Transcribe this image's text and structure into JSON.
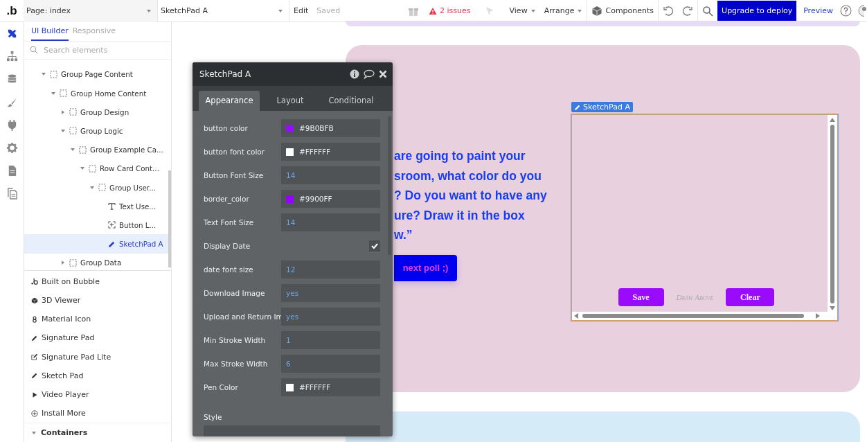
{
  "topbar": {
    "logo": ".b",
    "page_select": "Page: index",
    "element_select": "SketchPad A",
    "edit": "Edit",
    "saved": "Saved",
    "issues": "2 issues",
    "menus": [
      "View",
      "Arrange"
    ],
    "components": "Components",
    "upgrade": "Upgrade to deploy",
    "preview": "Preview"
  },
  "rail": [
    {
      "kind": "design",
      "selected": true
    },
    {
      "kind": "tree",
      "selected": false
    },
    {
      "kind": "data",
      "selected": false
    },
    {
      "kind": "brush",
      "selected": false
    },
    {
      "kind": "plug",
      "selected": false
    },
    {
      "kind": "gear",
      "selected": false
    },
    {
      "kind": "doc",
      "selected": false
    },
    {
      "kind": "docs",
      "selected": false
    }
  ],
  "sidebar": {
    "tabs": [
      {
        "label": "UI Builder",
        "selected": true
      },
      {
        "label": "Responsive",
        "selected": false
      }
    ],
    "search": {
      "placeholder": "Search elements"
    },
    "tree": [
      {
        "label": "Group Page Content",
        "kind": "group",
        "expanded": true,
        "selected": false,
        "children": [
          {
            "label": "Group Home Content",
            "kind": "group",
            "expanded": true,
            "selected": false,
            "children": [
              {
                "label": "Group Design",
                "kind": "group",
                "expanded": false,
                "selected": false
              },
              {
                "label": "Group Logic",
                "kind": "group",
                "expanded": true,
                "selected": false,
                "children": [
                  {
                    "label": "Group Example Ca...",
                    "kind": "group",
                    "expanded": true,
                    "selected": false,
                    "children": [
                      {
                        "label": "Row Card Cont...",
                        "kind": "group",
                        "expanded": true,
                        "selected": false,
                        "children": [
                          {
                            "label": "Group User...",
                            "kind": "group",
                            "expanded": true,
                            "selected": false,
                            "children": [
                              {
                                "label": "Text Use...",
                                "kind": "text",
                                "selected": false
                              },
                              {
                                "label": "Button L...",
                                "kind": "button",
                                "selected": false
                              },
                              {
                                "label": "SketchPad A",
                                "kind": "sketch",
                                "selected": true
                              }
                            ]
                          }
                        ]
                      }
                    ]
                  }
                ]
              },
              {
                "label": "Group Data",
                "kind": "group",
                "expanded": false,
                "selected": false
              }
            ]
          }
        ]
      }
    ],
    "plugins": [
      {
        "label": "Built on Bubble",
        "kind": "bubble"
      },
      {
        "label": "3D Viewer",
        "kind": "cube"
      },
      {
        "label": "Material Icon",
        "kind": "glyph"
      },
      {
        "label": "Signature Pad",
        "kind": "pencil"
      },
      {
        "label": "Signature Pad Lite",
        "kind": "edit"
      },
      {
        "label": "Sketch Pad",
        "kind": "pencil"
      },
      {
        "label": "Video Player",
        "kind": "play"
      },
      {
        "label": "Install More",
        "kind": "add"
      }
    ],
    "section": {
      "label": "Containers",
      "expanded": true
    }
  },
  "panel": {
    "title": "SketchPad A",
    "tabs": [
      {
        "label": "Appearance",
        "selected": true
      },
      {
        "label": "Layout",
        "selected": false
      },
      {
        "label": "Conditional",
        "selected": false
      }
    ],
    "properties": [
      {
        "label": "button color",
        "kind": "color",
        "value": "#9B0BFB",
        "color": "#9b0bfb"
      },
      {
        "label": "button font color",
        "kind": "color",
        "value": "#FFFFFF",
        "color": "#ffffff"
      },
      {
        "label": "Button Font Size",
        "kind": "number",
        "value": "14"
      },
      {
        "label": "border_color",
        "kind": "color",
        "value": "#9900FF",
        "color": "#9900ff"
      },
      {
        "label": "Text Font Size",
        "kind": "number",
        "value": "14"
      },
      {
        "label": "Display Date",
        "kind": "checkbox",
        "checked": true
      },
      {
        "label": "date font size",
        "kind": "number",
        "value": "12"
      },
      {
        "label": "Download Image",
        "kind": "number",
        "value": "yes"
      },
      {
        "label": "Upload and Return Im",
        "kind": "number",
        "value": "yes"
      },
      {
        "label": "Min Stroke Width",
        "kind": "number",
        "value": "1"
      },
      {
        "label": "Max Stroke Width",
        "kind": "number",
        "value": "6"
      },
      {
        "label": "Pen Color",
        "kind": "color",
        "value": "#FFFFFF",
        "color": "#ffffff"
      }
    ],
    "style_label": "Style"
  },
  "canvas": {
    "question": "are going to paint your\nsroom, what color do you\n? Do you want to have any\nure? Draw it in the box\nw.”",
    "button": "next poll ;)",
    "sketchpad": {
      "tag": "SketchPad A",
      "save": "Save",
      "hint": "Draw Above",
      "clear": "Clear"
    }
  }
}
